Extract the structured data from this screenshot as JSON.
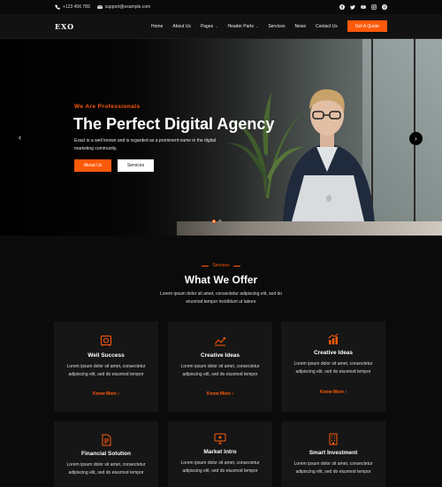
{
  "topbar": {
    "phone": "+123 456 789",
    "email": "support@example.com",
    "socials": [
      "facebook-icon",
      "twitter-icon",
      "youtube-icon",
      "instagram-icon",
      "pinterest-icon"
    ]
  },
  "nav": {
    "logo": "EXO",
    "items": [
      {
        "label": "Home",
        "dropdown": false
      },
      {
        "label": "About Us",
        "dropdown": false
      },
      {
        "label": "Pages",
        "dropdown": true
      },
      {
        "label": "Header Parts",
        "dropdown": true
      },
      {
        "label": "Services",
        "dropdown": false
      },
      {
        "label": "News",
        "dropdown": false
      },
      {
        "label": "Contact Us",
        "dropdown": false
      }
    ],
    "cta": "Get A Quote"
  },
  "hero": {
    "tag": "We Are Professionals",
    "title": "The Perfect Digital Agency",
    "description": "Exact is a well known and is regarded as a prominent name in the digital marketing community.",
    "primary_button": "About Us",
    "secondary_button": "Services",
    "slide_count": 2,
    "active_slide": 0
  },
  "services": {
    "tag": "Services",
    "title": "What We Offer",
    "subtitle": "Lorem ipsum dolor sit amet, consectetur adipiscing elit, sed do eiusmod tempor incididunt ut labore",
    "cards": [
      {
        "icon": "safe-icon",
        "title": "Well Success",
        "description": "Lorem ipsum dolor sit amet, consectetur adipiscing elit, sed do eiusmod tempor",
        "link": "Know More"
      },
      {
        "icon": "chart-icon",
        "title": "Creative Ideas",
        "description": "Lorem ipsum dolor sit amet, consectetur adipiscing elit, sed do eiusmod tempor",
        "link": "Know More"
      },
      {
        "icon": "growth-icon",
        "title": "Creative Ideas",
        "description": "Lorem ipsum dolor sit amet, consectetur adipiscing elit, sed do eiusmod tempor",
        "link": "Know More"
      },
      {
        "icon": "document-icon",
        "title": "Financial Solution",
        "description": "Lorem ipsum dolor sit amet, consectetur adipiscing elit, sed do eiusmod tempor",
        "link": "Know More"
      },
      {
        "icon": "monitor-icon",
        "title": "Market Intro",
        "description": "Lorem ipsum dolor sit amet, consectetur adipiscing elit, sed do eiusmod tempor",
        "link": "Know More"
      },
      {
        "icon": "building-icon",
        "title": "Smart Investment",
        "description": "Lorem ipsum dolor sit amet, consectetur adipiscing elit, sed do eiusmod tempor",
        "link": "Know More"
      }
    ]
  },
  "colors": {
    "accent": "#ff5a0a",
    "background": "#0b0b0b",
    "card": "#161616"
  }
}
